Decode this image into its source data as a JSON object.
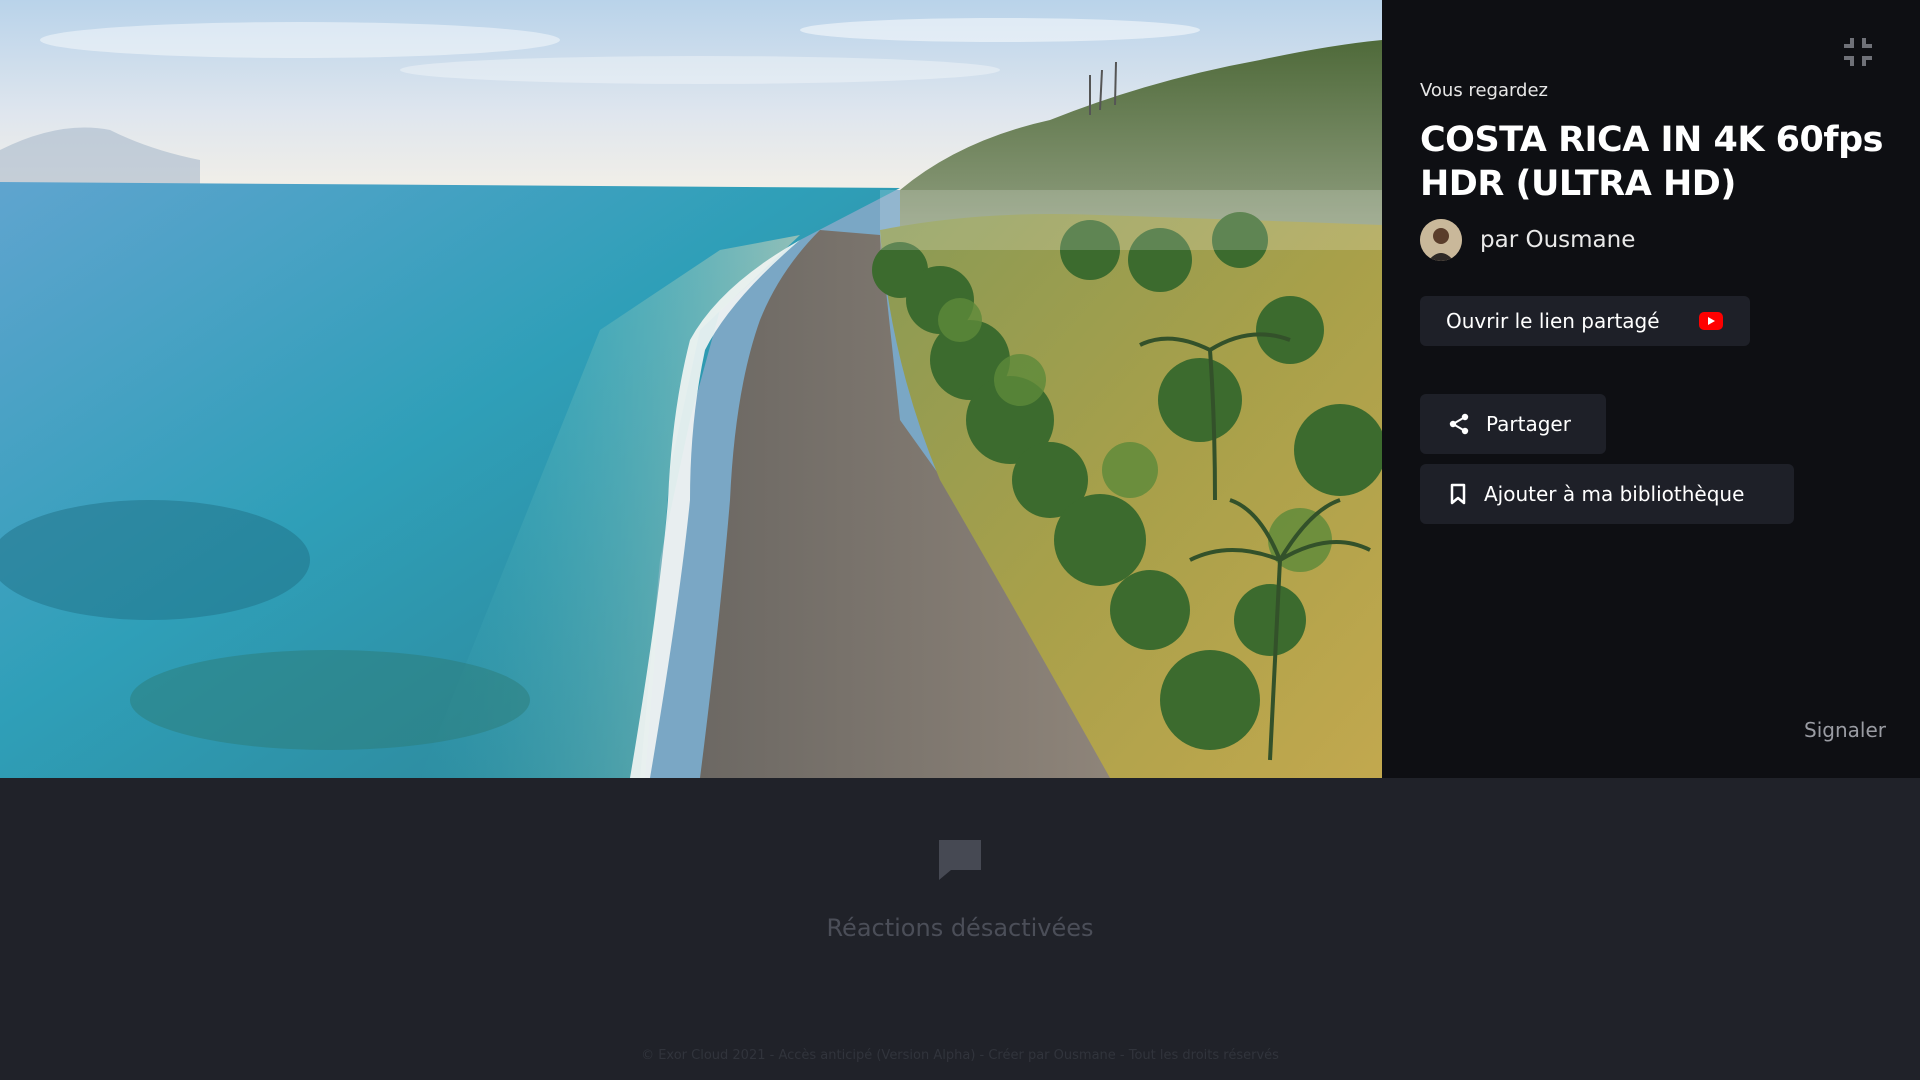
{
  "panel": {
    "watching_label": "Vous regardez",
    "title": "COSTA RICA IN 4K 60fps HDR (ULTRA HD)",
    "author": "par Ousmane",
    "open_link_label": "Ouvrir le lien partagé",
    "share_label": "Partager",
    "library_label": "Ajouter à ma bibliothèque",
    "report_label": "Signaler"
  },
  "reactions": {
    "disabled_label": "Réactions désactivées"
  },
  "footer": {
    "text": "© Exor Cloud 2021 - Accès anticipé (Version Alpha) - Créer par Ousmane - Tout les droits réservés"
  },
  "icons": {
    "collapse": "fullscreen-exit-icon",
    "youtube": "youtube-icon",
    "share": "share-icon",
    "bookmark": "bookmark-icon",
    "chat": "chat-bubble-icon"
  },
  "colors": {
    "panel_bg": "#0e0f13",
    "button_bg": "#1e2028",
    "page_bg": "#202229",
    "youtube_red": "#ff0000"
  }
}
